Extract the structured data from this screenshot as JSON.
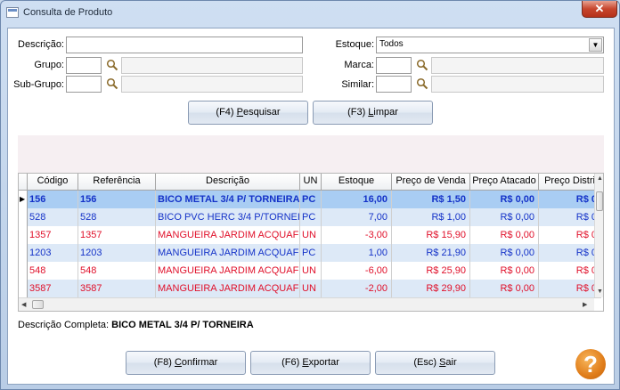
{
  "window": {
    "title": "Consulta de Produto",
    "close_label": "✕"
  },
  "form": {
    "descricao_label": "Descrição:",
    "descricao_value": "",
    "grupo_label": "Grupo:",
    "subgrupo_label": "Sub-Grupo:",
    "estoque_label": "Estoque:",
    "estoque_value": "Todos",
    "marca_label": "Marca:",
    "similar_label": "Similar:"
  },
  "buttons": {
    "pesquisar_prefix": "(F4) ",
    "pesquisar_key": "P",
    "pesquisar_rest": "esquisar",
    "limpar_prefix": "(F3) ",
    "limpar_key": "L",
    "limpar_rest": "impar",
    "confirmar_prefix": "(F8) ",
    "confirmar_key": "C",
    "confirmar_rest": "onfirmar",
    "exportar_prefix": "(F6) ",
    "exportar_key": "E",
    "exportar_rest": "xportar",
    "sair_prefix": "(Esc) ",
    "sair_key": "S",
    "sair_rest": "air"
  },
  "table": {
    "columns": [
      "Código",
      "Referência",
      "Descrição",
      "UN",
      "Estoque",
      "Preço de Venda",
      "Preço Atacado",
      "Preço Distri"
    ],
    "rows": [
      [
        "156",
        "156",
        "BICO METAL 3/4 P/ TORNEIRA",
        "PC",
        "16,00",
        "R$ 1,50",
        "R$ 0,00",
        "R$ 0"
      ],
      [
        "528",
        "528",
        "BICO PVC HERC 3/4 P/TORNEIRA",
        "PC",
        "7,00",
        "R$ 1,00",
        "R$ 0,00",
        "R$ 0"
      ],
      [
        "1357",
        "1357",
        "MANGUEIRA JARDIM ACQUAFLEX",
        "UN",
        "-3,00",
        "R$ 15,90",
        "R$ 0,00",
        "R$ 0"
      ],
      [
        "1203",
        "1203",
        "MANGUEIRA JARDIM ACQUAFLEX",
        "PC",
        "1,00",
        "R$ 21,90",
        "R$ 0,00",
        "R$ 0"
      ],
      [
        "548",
        "548",
        "MANGUEIRA JARDIM ACQUAFLEX",
        "UN",
        "-6,00",
        "R$ 25,90",
        "R$ 0,00",
        "R$ 0"
      ],
      [
        "3587",
        "3587",
        "MANGUEIRA JARDIM ACQUAFLEX",
        "UN",
        "-2,00",
        "R$ 29,90",
        "R$ 0,00",
        "R$ 0"
      ]
    ],
    "row_colors": [
      "#1432c8",
      "#1432c8",
      "#e0102a",
      "#1432c8",
      "#e0102a",
      "#e0102a"
    ]
  },
  "detail": {
    "label": "Descrição Completa:",
    "value": "BICO METAL 3/4 P/ TORNEIRA"
  },
  "help_label": "?"
}
